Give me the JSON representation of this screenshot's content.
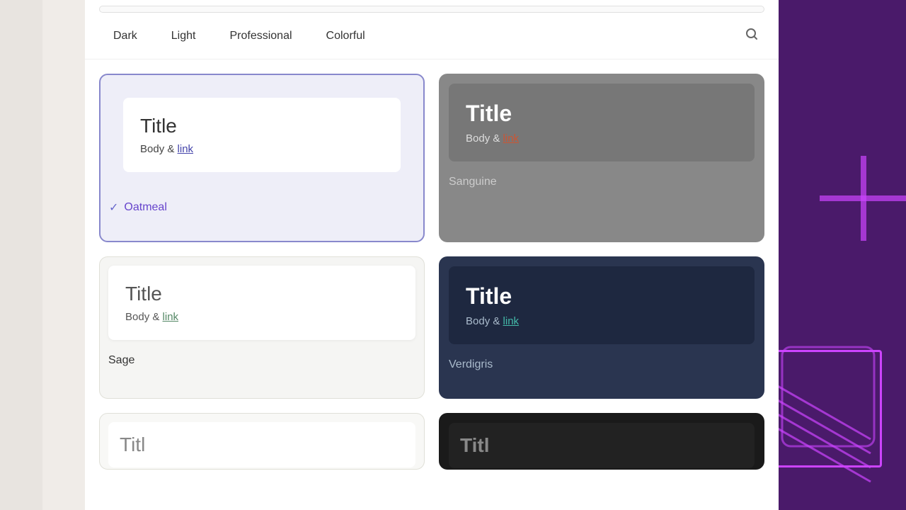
{
  "filter_tabs": {
    "dark": "Dark",
    "light": "Light",
    "professional": "Professional",
    "colorful": "Colorful"
  },
  "themes": {
    "oatmeal": {
      "name": "Oatmeal",
      "selected": true,
      "title": "Title",
      "body": "Body & ",
      "link": "link"
    },
    "sanguine": {
      "name": "Sanguine",
      "selected": false,
      "title": "Title",
      "body": "Body & ",
      "link": "link"
    },
    "sage": {
      "name": "Sage",
      "selected": false,
      "title": "Title",
      "body": "Body & ",
      "link": "link"
    },
    "verdigris": {
      "name": "Verdigris",
      "selected": false,
      "title": "Title",
      "body": "Body & ",
      "link": "link"
    }
  }
}
